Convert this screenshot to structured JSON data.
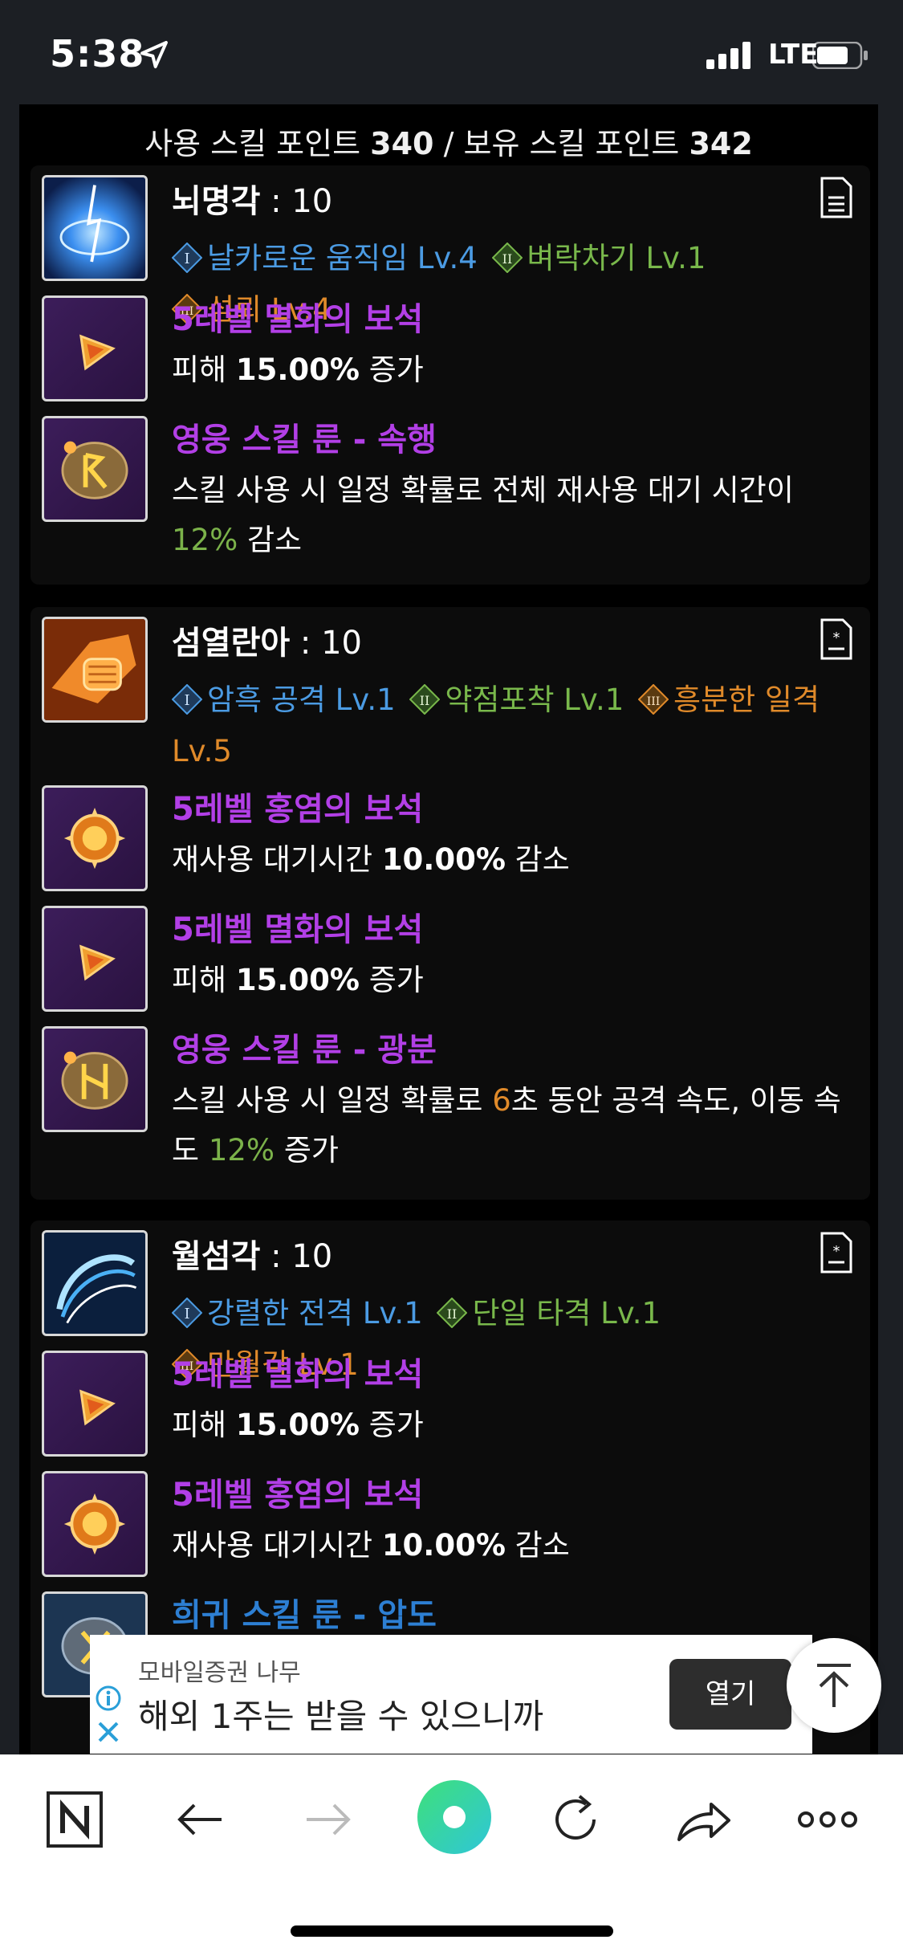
{
  "status_bar": {
    "time": "5:38",
    "network": "LTE"
  },
  "points": {
    "used_label": "사용 스킬 포인트",
    "used": "340",
    "separator": "/",
    "owned_label": "보유 스킬 포인트",
    "owned": "342"
  },
  "skills": [
    {
      "name": "뇌명각",
      "level_text": " : 10",
      "tripods": [
        {
          "tier": "I",
          "text": "날카로운 움직임 Lv.4"
        },
        {
          "tier": "II",
          "text": "벼락차기 Lv.1"
        },
        {
          "tier": "III",
          "text": "섬뢰 Lv.4"
        }
      ],
      "items": [
        {
          "title": "5레벨 멸화의 보석",
          "desc_pre": "피해 ",
          "desc_bold": "15.00%",
          "desc_post": " 증가"
        },
        {
          "title": "영웅 스킬 룬 - 속행",
          "desc_pre": "스킬 사용 시 일정 확률로 전체 재사용 대기 시간이 ",
          "desc_green": "12%",
          "desc_post": " 감소"
        }
      ]
    },
    {
      "name": "섬열란아",
      "level_text": " : 10",
      "tripods": [
        {
          "tier": "I",
          "text": "암흑 공격 Lv.1"
        },
        {
          "tier": "II",
          "text": "약점포착 Lv.1"
        },
        {
          "tier": "III",
          "text": "흥분한 일격 Lv.5"
        }
      ],
      "items": [
        {
          "title": "5레벨 홍염의 보석",
          "desc_pre": "재사용 대기시간 ",
          "desc_bold": "10.00%",
          "desc_post": " 감소"
        },
        {
          "title": "5레벨 멸화의 보석",
          "desc_pre": "피해 ",
          "desc_bold": "15.00%",
          "desc_post": " 증가"
        },
        {
          "title": "영웅 스킬 룬 - 광분",
          "desc_pre": "스킬 사용 시 일정 확률로 ",
          "desc_orange": "6",
          "desc_mid": "초 동안 공격 속도, 이동 속도 ",
          "desc_green": "12%",
          "desc_post": " 증가"
        }
      ]
    },
    {
      "name": "월섬각",
      "level_text": " : 10",
      "tripods": [
        {
          "tier": "I",
          "text": "강렬한 전격 Lv.1"
        },
        {
          "tier": "II",
          "text": "단일 타격 Lv.1"
        },
        {
          "tier": "III",
          "text": "만월각 Lv.1"
        }
      ],
      "items": [
        {
          "title": "5레벨 멸화의 보석",
          "desc_pre": "피해 ",
          "desc_bold": "15.00%",
          "desc_post": " 증가"
        },
        {
          "title": "5레벨 홍염의 보석",
          "desc_pre": "재사용 대기시간 ",
          "desc_bold": "10.00%",
          "desc_post": " 감소"
        },
        {
          "title": "희귀 스킬 룬 - 압도"
        }
      ]
    }
  ],
  "ad": {
    "sponsor": "모바일증권 나무",
    "text": "해외 1주는 받을 수 있으니까",
    "button": "열기"
  },
  "toolbar": {
    "icons": [
      "naver-n-icon",
      "back-arrow-icon",
      "forward-arrow-icon",
      "green-orb-icon",
      "refresh-icon",
      "share-icon",
      "more-icon"
    ]
  },
  "colors": {
    "tier1": "#4b9be3",
    "tier2": "#79b84b",
    "tier3": "#e08a2a",
    "epic": "#b23fe6",
    "rare": "#2d7fd3"
  }
}
